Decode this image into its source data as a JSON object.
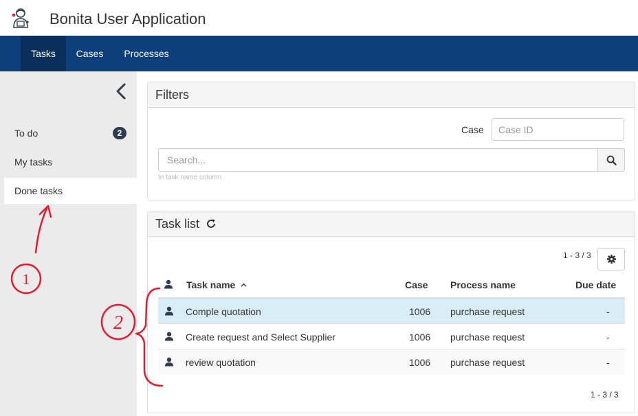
{
  "header": {
    "app_title": "Bonita User Application"
  },
  "nav": {
    "items": [
      {
        "label": "Tasks",
        "active": true
      },
      {
        "label": "Cases",
        "active": false
      },
      {
        "label": "Processes",
        "active": false
      }
    ]
  },
  "sidebar": {
    "items": [
      {
        "label": "To do",
        "badge": "2",
        "active": false
      },
      {
        "label": "My tasks",
        "badge": "",
        "active": false
      },
      {
        "label": "Done tasks",
        "badge": "",
        "active": true
      }
    ]
  },
  "filters": {
    "title": "Filters",
    "case_label": "Case",
    "case_placeholder": "Case ID",
    "search_placeholder": "Search...",
    "search_help": "In task name column"
  },
  "tasklist": {
    "title": "Task list",
    "pager": "1 - 3 / 3",
    "columns": {
      "task": "Task name",
      "case": "Case",
      "process": "Process name",
      "due": "Due date"
    },
    "rows": [
      {
        "task": "Comple quotation",
        "case": "1006",
        "process": "purchase request",
        "due": "-",
        "selected": true
      },
      {
        "task": "Create request and Select Supplier",
        "case": "1006",
        "process": "purchase request",
        "due": "-",
        "selected": false
      },
      {
        "task": "review quotation",
        "case": "1006",
        "process": "purchase request",
        "due": "-",
        "selected": false
      }
    ]
  },
  "annotations": {
    "marker_1": "1",
    "marker_2": "2",
    "ink_color": "#e8192c"
  },
  "colors": {
    "navbar": "#0d3f7a",
    "nav_active": "#0a2f5c",
    "selected_row": "#d9edf7",
    "badge": "#2c3e50"
  }
}
